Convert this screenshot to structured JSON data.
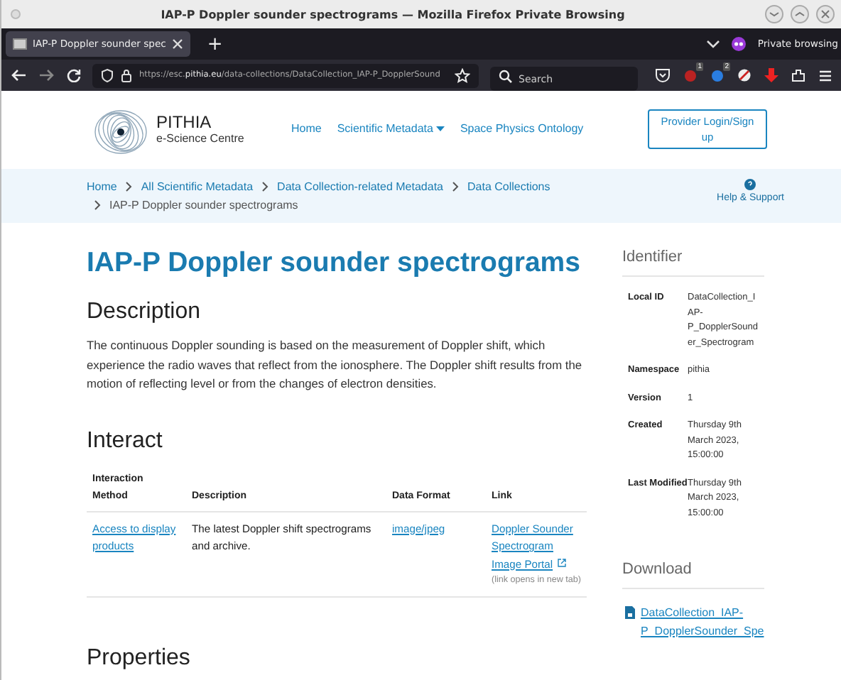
{
  "window": {
    "title": "IAP-P Doppler sounder spectrograms — Mozilla Firefox Private Browsing"
  },
  "browser": {
    "tabs": [
      {
        "label": "IAP-P Doppler sounder spec",
        "selected": true
      }
    ],
    "new_tab": "+",
    "private_label": "Private browsing",
    "url": {
      "prefix": "https://esc.",
      "domain": "pithia.eu",
      "path": "/data-collections/DataCollection_IAP-P_DopplerSound"
    },
    "search": {
      "placeholder": "Search"
    },
    "badges": [
      "1",
      "2"
    ]
  },
  "site": {
    "logo_title": "PITHIA",
    "logo_subtitle": "e-Science Centre",
    "nav": [
      {
        "label": "Home",
        "dropdown": false
      },
      {
        "label": "Scientific Metadata",
        "dropdown": true
      },
      {
        "label": "Space Physics Ontology",
        "dropdown": false
      }
    ],
    "login_button": "Provider Login/Sign up"
  },
  "breadcrumb": {
    "items": [
      "Home",
      "All Scientific Metadata",
      "Data Collection-related Metadata",
      "Data Collections"
    ],
    "current": "IAP-P Doppler sounder spectrograms",
    "help": "Help & Support"
  },
  "main": {
    "title": "IAP-P Doppler sounder spectrograms",
    "description_heading": "Description",
    "description": "The continuous Doppler sounding is based on the measurement of Doppler shift, which experience the radio waves that reflect from the ionosphere. The Doppler shift results from the motion of reflecting level or from the changes of electron densities.",
    "interact_heading": "Interact",
    "table": {
      "columns": [
        "Interaction Method",
        "Description",
        "Data Format",
        "Link"
      ],
      "rows": [
        {
          "method": "Access to display products",
          "description": "The latest Doppler shift spectrograms and archive.",
          "format": "image/jpeg",
          "link": "Doppler Sounder Spectrogram Image Portal",
          "link_note": "(link opens in new tab)"
        }
      ]
    },
    "properties_heading": "Properties"
  },
  "sidebar": {
    "identifier_heading": "Identifier",
    "identifier": [
      {
        "label": "Local ID",
        "value": "DataCollection_IAP-P_DopplerSounder_Spectrogram"
      },
      {
        "label": "Namespace",
        "value": "pithia"
      },
      {
        "label": "Version",
        "value": "1"
      },
      {
        "label": "Created",
        "value": "Thursday 9th March 2023, 15:00:00"
      },
      {
        "label": "Last Modified",
        "value": "Thursday 9th March 2023, 15:00:00"
      }
    ],
    "download_heading": "Download",
    "download_link": "DataCollection_IAP-P_DopplerSounder_Spe"
  }
}
